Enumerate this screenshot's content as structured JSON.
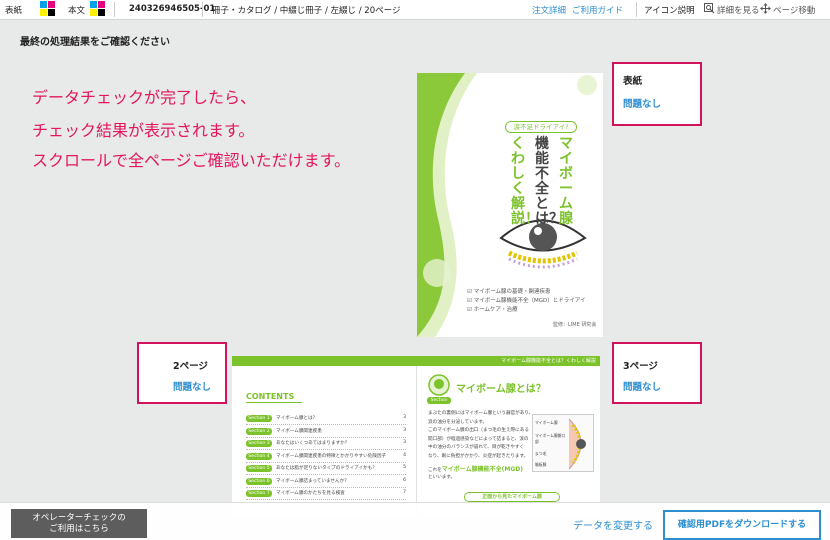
{
  "header": {
    "cover_label": "表紙",
    "body_label": "本文",
    "order_id": "240326946505-01",
    "product": "冊子・カタログ / 中綴じ冊子 / 左綴じ / 20ページ",
    "order_detail_link": "注文詳細",
    "guide_link": "ご利用ガイド",
    "icon_help": "アイコン説明",
    "view_detail": "詳細を見る",
    "page_move": "ページ移動"
  },
  "page_heading": "最終の処理結果をご確認ください",
  "message": [
    "データチェックが完了したら、",
    "チェック結果が表示されます。",
    "スクロールで全ページご確認いただけます。"
  ],
  "results": {
    "cover": {
      "title": "表紙",
      "status": "問題なし"
    },
    "page2": {
      "title": "2ページ",
      "status": "問題なし"
    },
    "page3": {
      "title": "3ページ",
      "status": "問題なし"
    }
  },
  "cover_page": {
    "badge": "涙不足ドライアイ?",
    "title_col1": "マイボーム腺",
    "title_col2": "機能不全とは？",
    "title_col3": "くわしく解説！",
    "bullets": [
      "マイボーム腺の基礎・関連疾患",
      "マイボーム腺機能不全（MGD）とドライアイ",
      "ホームケア・治療"
    ],
    "supervisor": "監修：LIME 研究会"
  },
  "spread_page": {
    "header_strip": "マイボーム腺機能不全とは？くわしく解説",
    "contents_title": "CONTENTS",
    "sections": [
      {
        "tag": "Section 1",
        "text": "マイボーム腺とは？",
        "page": "3"
      },
      {
        "tag": "Section 2",
        "text": "マイボーム腺関連疾患",
        "page": "3"
      },
      {
        "tag": "Section 3",
        "text": "あなたはいくつあてはまりますか？",
        "page": "3"
      },
      {
        "tag": "Section 4",
        "text": "マイボーム腺関連疾患の特徴とかかりやすい危険因子",
        "page": "4"
      },
      {
        "tag": "Section 5",
        "text": "あなたは脂が足りないタイプのドライアイかも？",
        "page": "5"
      },
      {
        "tag": "Section 6",
        "text": "マイボーム腺詰まっていませんか？",
        "page": "6"
      },
      {
        "tag": "Section 7",
        "text": "マイボーム腺のかたちを見る検査",
        "page": "7"
      }
    ],
    "section_badge": "Section",
    "right_title": "マイボーム腺とは？",
    "paragraph": [
      "まぶたの裏側にはマイボーム腺という器官があり、",
      "涙の油分を分泌しています。",
      "このマイボーム腺の出口（まつ毛の生え際にある",
      "開口部）が経過感染などによって詰まると、涙の",
      "中の油分のバランスが崩れて、目が乾きやすく",
      "なり、眼に負担がかかり、炎症が起きたります。"
    ],
    "mgd_prefix": "これを",
    "mgd_term": "マイボーム腺機能不全(MGD)",
    "mgd_suffix": "といいます。",
    "diagram_labels": [
      "マイボーム腺",
      "マイボーム腺開口部",
      "まつ毛",
      "瞼板腺"
    ],
    "subhead": "正面から見たマイボーム腺"
  },
  "footer": {
    "operator_line1": "オペレーターチェックの",
    "operator_line2": "ご利用はこちら",
    "change_data": "データを変更する",
    "download": "確認用PDFをダウンロードする"
  },
  "colors": {
    "accent": "#e5155e",
    "link": "#2d8fd0",
    "green": "#7cc22b"
  }
}
